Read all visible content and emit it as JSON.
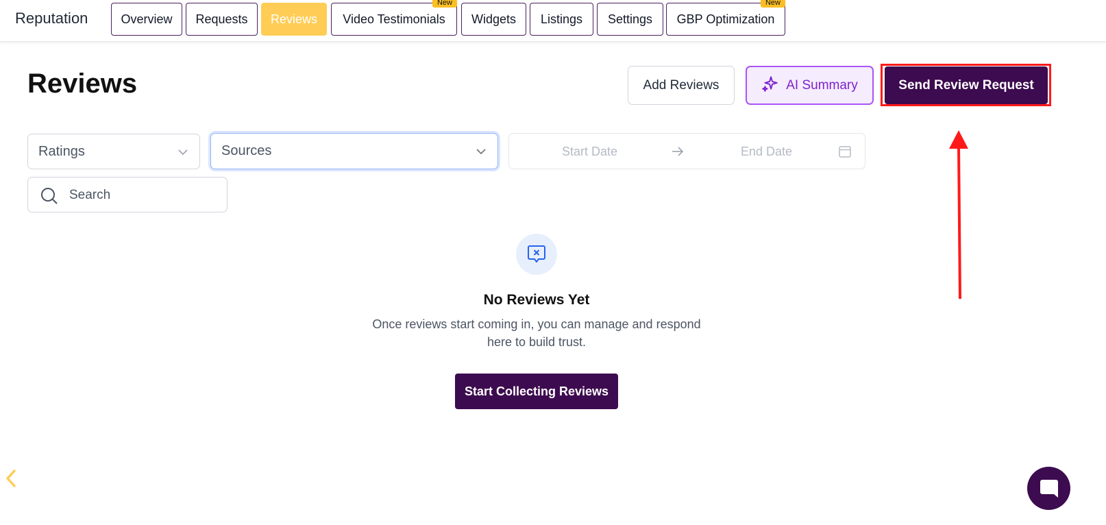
{
  "header": {
    "app_title": "Reputation",
    "tabs": [
      {
        "label": "Overview",
        "active": false,
        "badge": ""
      },
      {
        "label": "Requests",
        "active": false,
        "badge": ""
      },
      {
        "label": "Reviews",
        "active": true,
        "badge": ""
      },
      {
        "label": "Video Testimonials",
        "active": false,
        "badge": "New"
      },
      {
        "label": "Widgets",
        "active": false,
        "badge": ""
      },
      {
        "label": "Listings",
        "active": false,
        "badge": ""
      },
      {
        "label": "Settings",
        "active": false,
        "badge": ""
      },
      {
        "label": "GBP Optimization",
        "active": false,
        "badge": "New"
      }
    ]
  },
  "page": {
    "title": "Reviews",
    "actions": {
      "add_reviews": "Add Reviews",
      "ai_summary": "AI Summary",
      "send_review_request": "Send Review Request"
    }
  },
  "filters": {
    "ratings": "Ratings",
    "sources": "Sources",
    "start_date": "Start Date",
    "end_date": "End Date",
    "search_placeholder": "Search"
  },
  "empty_state": {
    "title": "No Reviews Yet",
    "description": "Once reviews start coming in, you can manage and respond here to build trust.",
    "cta": "Start Collecting Reviews"
  },
  "colors": {
    "accent_dark": "#3d0b4f",
    "tab_active": "#ffcd55",
    "ai_purple": "#a855f7",
    "highlight_red": "#ff1a1a"
  },
  "icons": [
    "sparkle-icon",
    "chevron-down-icon",
    "arrow-right-icon",
    "calendar-icon",
    "search-icon",
    "message-x-icon",
    "chevron-left-icon",
    "chat-icon"
  ]
}
